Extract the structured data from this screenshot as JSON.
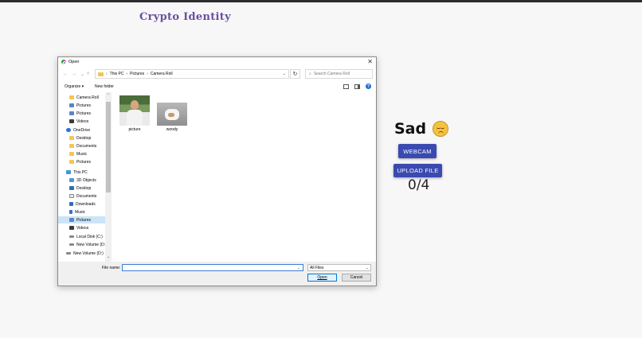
{
  "app": {
    "title": "Crypto Identity"
  },
  "emotion": {
    "label": "Sad",
    "icon": "sad-face-icon"
  },
  "buttons": {
    "webcam": "WEBCAM",
    "upload": "UPLOAD FILE"
  },
  "counter": "0/4",
  "dialog": {
    "title": "Open",
    "breadcrumb": [
      "This PC",
      "Pictures",
      "Camera Roll"
    ],
    "search_placeholder": "Search Camera Roll",
    "toolbar": {
      "organize": "Organize ▾",
      "new_folder": "New folder"
    },
    "nav_items": [
      {
        "label": "Camera Roll",
        "icon": "folder-icon"
      },
      {
        "label": "Pictures",
        "icon": "pictures-icon"
      },
      {
        "label": "Pictures",
        "icon": "pictures-icon"
      },
      {
        "label": "Videos",
        "icon": "videos-icon"
      },
      {
        "label": "OneDrive",
        "icon": "onedrive-icon"
      },
      {
        "label": "Desktop",
        "icon": "folder-icon"
      },
      {
        "label": "Documents",
        "icon": "folder-icon"
      },
      {
        "label": "Music",
        "icon": "folder-icon"
      },
      {
        "label": "Pictures",
        "icon": "folder-icon"
      },
      {
        "label": "This PC",
        "icon": "computer-icon"
      },
      {
        "label": "3D Objects",
        "icon": "3d-objects-icon"
      },
      {
        "label": "Desktop",
        "icon": "desktop-icon"
      },
      {
        "label": "Documents",
        "icon": "documents-icon"
      },
      {
        "label": "Downloads",
        "icon": "downloads-icon"
      },
      {
        "label": "Music",
        "icon": "music-icon"
      },
      {
        "label": "Pictures",
        "icon": "pictures-icon",
        "selected": true
      },
      {
        "label": "Videos",
        "icon": "videos-icon"
      },
      {
        "label": "Local Disk (C:)",
        "icon": "drive-icon"
      },
      {
        "label": "New Volume (D:",
        "icon": "drive-icon"
      },
      {
        "label": "New Volume (D:)",
        "icon": "drive-icon"
      }
    ],
    "files": [
      {
        "name": "picture",
        "icon": "photo-thumbnail-icon"
      },
      {
        "name": "woody",
        "icon": "photo-thumbnail-icon"
      }
    ],
    "file_name_label": "File name:",
    "file_name_value": "",
    "file_type": "All Files",
    "open_label": "Open",
    "cancel_label": "Cancel"
  }
}
